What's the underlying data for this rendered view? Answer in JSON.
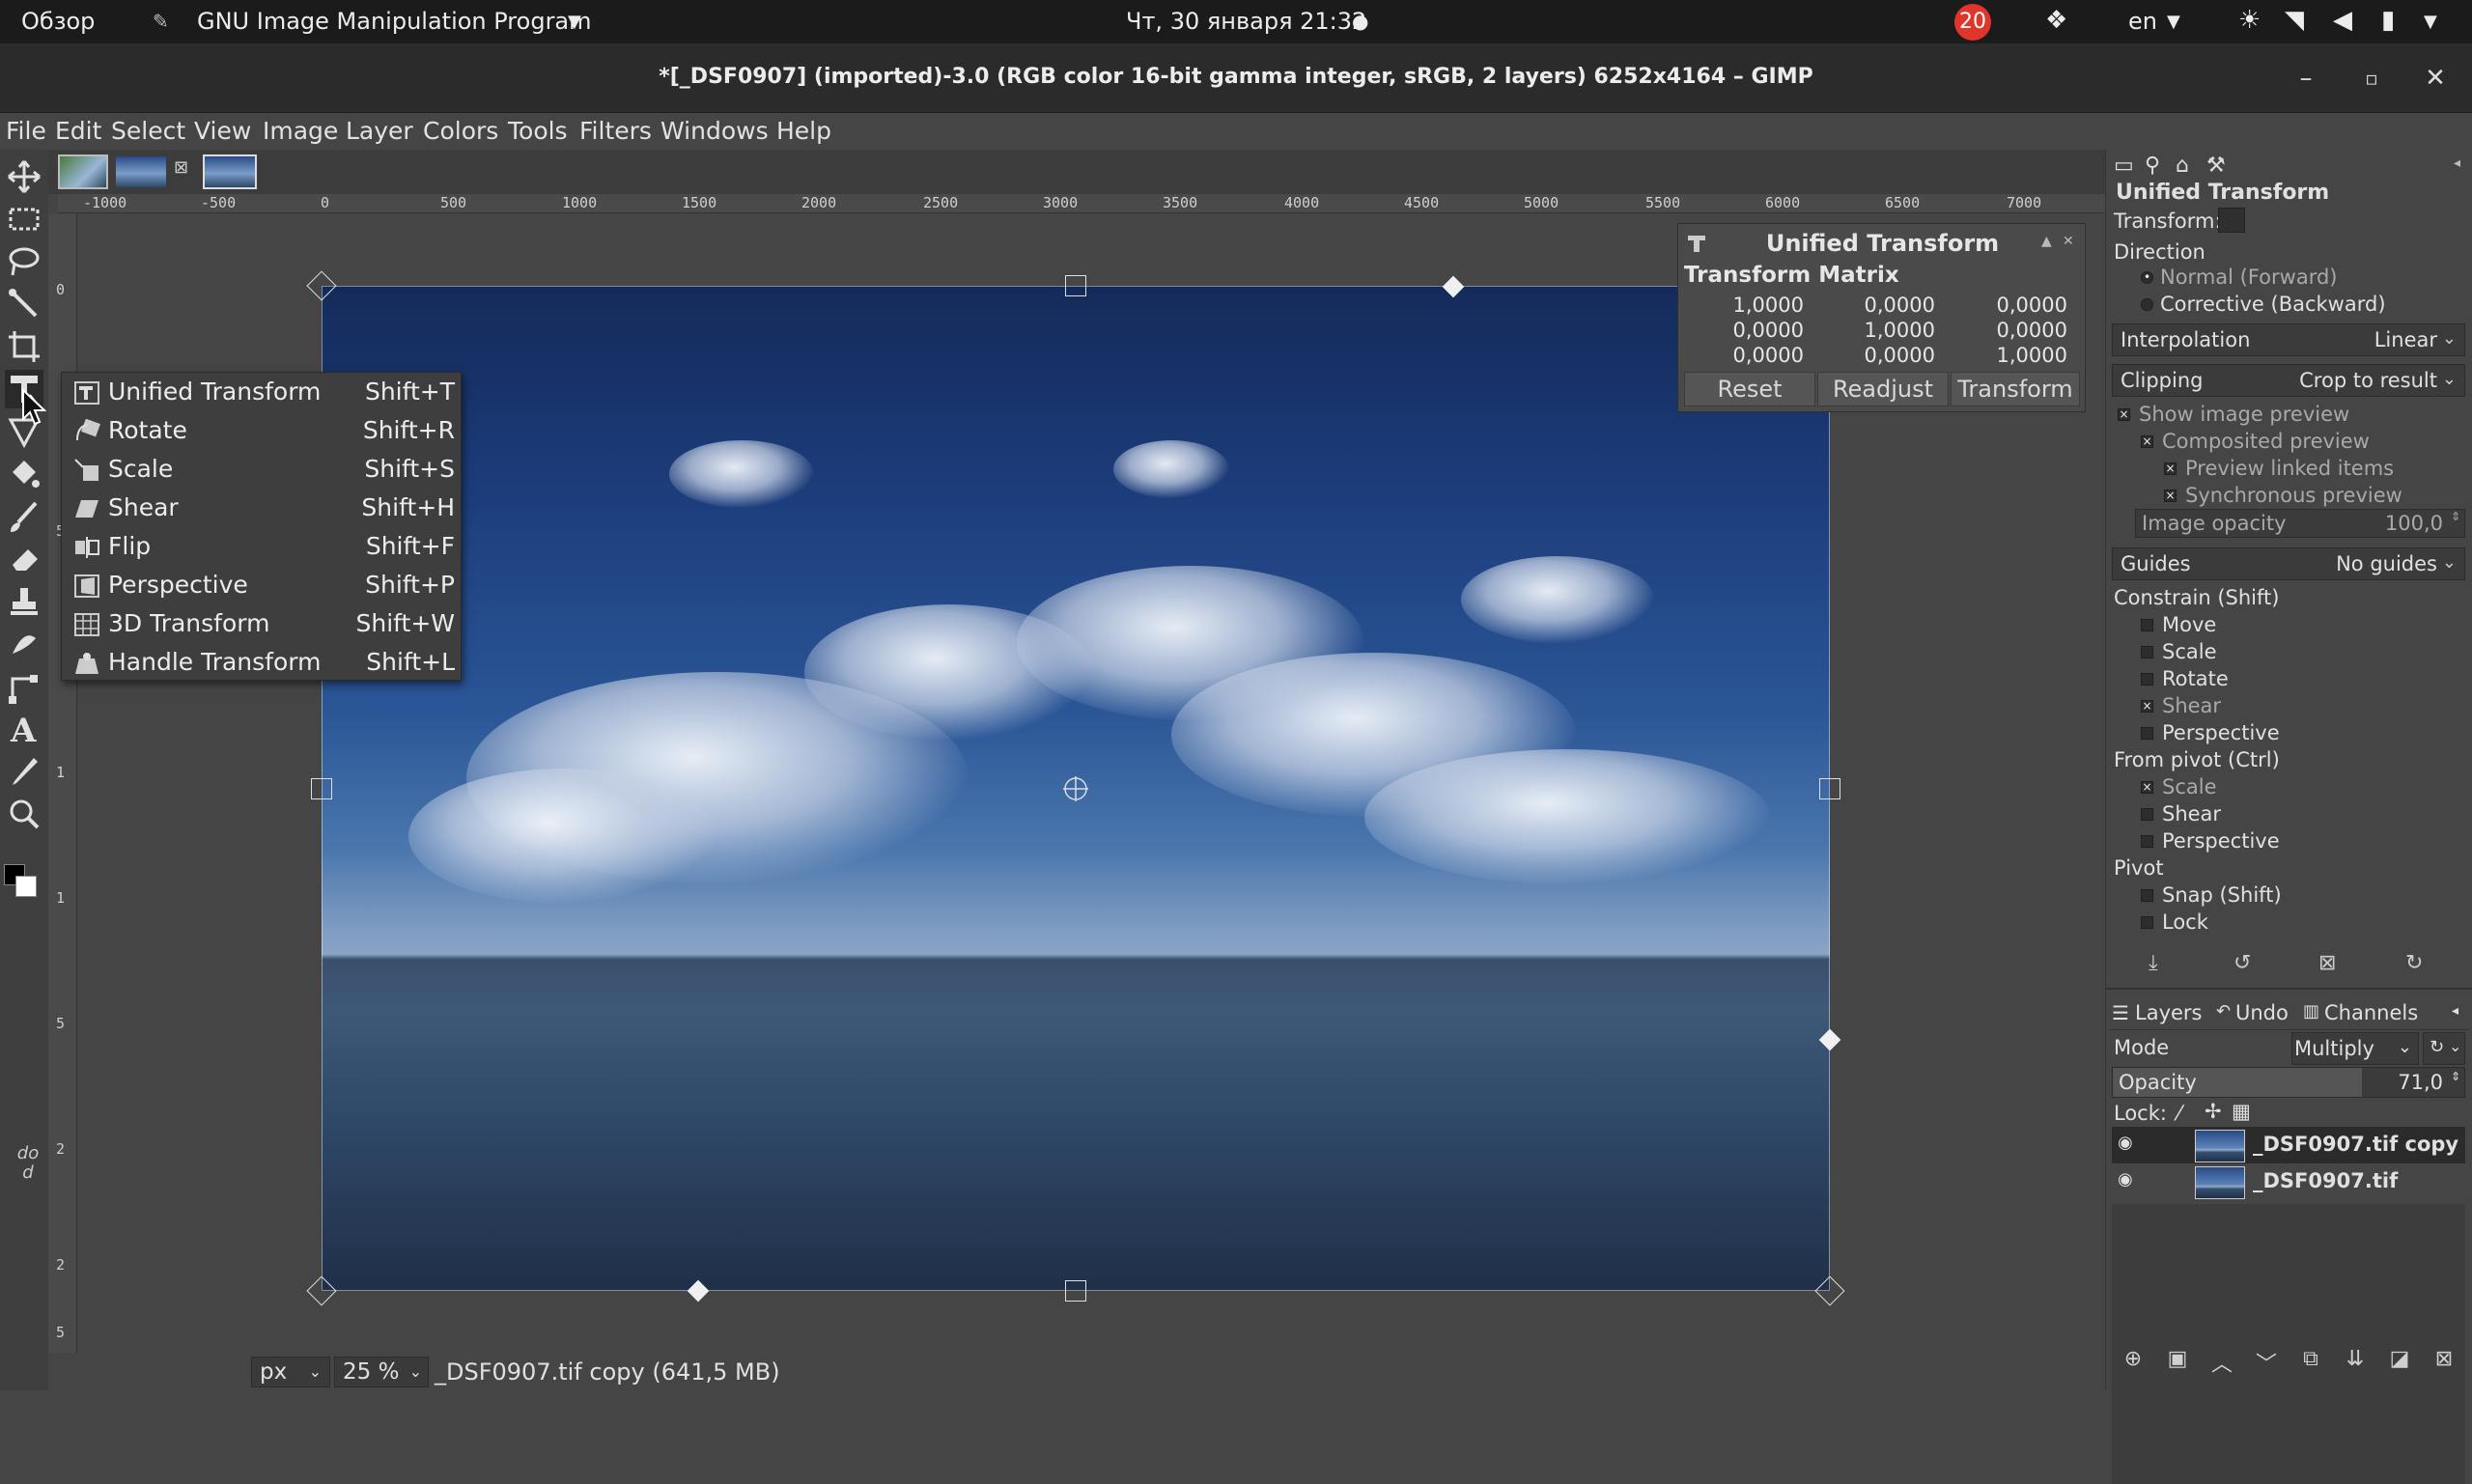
{
  "topbar": {
    "overview": "Обзор",
    "app_name": "GNU Image Manipulation Program",
    "clock": "Чт, 30 января  21:32",
    "notifications_count": "20",
    "language": "en"
  },
  "window": {
    "title": "*[_DSF0907] (imported)-3.0 (RGB color 16-bit gamma integer, sRGB, 2 layers) 6252x4164 – GIMP"
  },
  "menubar": [
    "File",
    "Edit",
    "Select",
    "View",
    "Image",
    "Layer",
    "Colors",
    "Tools",
    "Filters",
    "Windows",
    "Help"
  ],
  "ruler": {
    "h_ticks": [
      "-1000",
      "-500",
      "0",
      "500",
      "1000",
      "1500",
      "2000",
      "2500",
      "3000",
      "3500",
      "4000",
      "4500",
      "5000",
      "5500",
      "6000",
      "6500",
      "7000"
    ],
    "v_ticks": [
      "0",
      "5",
      "1",
      "1",
      "5",
      "2",
      "2",
      "5"
    ]
  },
  "tool_menu": {
    "items": [
      {
        "label": "Unified Transform",
        "shortcut": "Shift+T"
      },
      {
        "label": "Rotate",
        "shortcut": "Shift+R"
      },
      {
        "label": "Scale",
        "shortcut": "Shift+S"
      },
      {
        "label": "Shear",
        "shortcut": "Shift+H"
      },
      {
        "label": "Flip",
        "shortcut": "Shift+F"
      },
      {
        "label": "Perspective",
        "shortcut": "Shift+P"
      },
      {
        "label": "3D Transform",
        "shortcut": "Shift+W"
      },
      {
        "label": "Handle Transform",
        "shortcut": "Shift+L"
      }
    ]
  },
  "toolbox_label": "do d",
  "ut_dialog": {
    "title": "Unified Transform",
    "subtitle": "Transform Matrix",
    "matrix": [
      [
        "1,0000",
        "0,0000",
        "0,0000"
      ],
      [
        "0,0000",
        "1,0000",
        "0,0000"
      ],
      [
        "0,0000",
        "0,0000",
        "1,0000"
      ]
    ],
    "buttons": {
      "reset": "Reset",
      "readjust": "Readjust",
      "transform": "Transform"
    }
  },
  "status": {
    "unit": "px",
    "zoom": "25 %",
    "info": "_DSF0907.tif copy (641,5 MB)"
  },
  "tool_options": {
    "title": "Unified Transform",
    "transform_label": "Transform:",
    "direction_label": "Direction",
    "direction_normal": "Normal (Forward)",
    "direction_corrective": "Corrective (Backward)",
    "interpolation_label": "Interpolation",
    "interpolation_value": "Linear",
    "clipping_label": "Clipping",
    "clipping_value": "Crop to result",
    "show_preview": "Show image preview",
    "composited_preview": "Composited preview",
    "preview_linked": "Preview linked items",
    "synchronous_preview": "Synchronous preview",
    "image_opacity_label": "Image opacity",
    "image_opacity_value": "100,0",
    "guides_label": "Guides",
    "guides_value": "No guides",
    "constrain_label": "Constrain (Shift)",
    "constrain_items": [
      "Move",
      "Scale",
      "Rotate",
      "Shear",
      "Perspective"
    ],
    "constrain_checked": [
      false,
      false,
      false,
      true,
      false
    ],
    "from_pivot_label": "From pivot  (Ctrl)",
    "from_pivot_items": [
      "Scale",
      "Shear",
      "Perspective"
    ],
    "from_pivot_checked": [
      true,
      false,
      false
    ],
    "pivot_label": "Pivot",
    "pivot_items": [
      "Snap (Shift)",
      "Lock"
    ],
    "pivot_checked": [
      false,
      false
    ]
  },
  "layers_panel": {
    "tabs": [
      "Layers",
      "Undo",
      "Channels"
    ],
    "mode_label": "Mode",
    "mode_value": "Multiply",
    "opacity_label": "Opacity",
    "opacity_value": "71,0",
    "opacity_level": 0.71,
    "lock_label": "Lock:",
    "layers": [
      {
        "name": "_DSF0907.tif copy",
        "selected": true
      },
      {
        "name": "_DSF0907.tif",
        "selected": false
      }
    ]
  }
}
